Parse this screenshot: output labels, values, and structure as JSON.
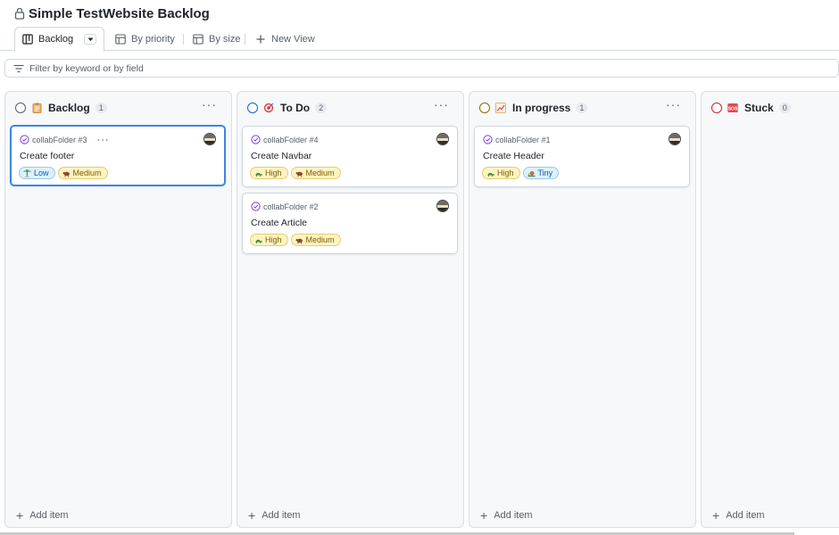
{
  "project": {
    "title": "Simple TestWebsite Backlog"
  },
  "tabs": [
    {
      "label": "Backlog",
      "icon": "board-icon",
      "active": true
    },
    {
      "label": "By priority",
      "icon": "table-icon"
    },
    {
      "label": "By size",
      "icon": "table-icon"
    },
    {
      "label": "New View",
      "icon": "plus-icon"
    }
  ],
  "filter": {
    "placeholder": "Filter by keyword or by field"
  },
  "columns": [
    {
      "name": "Backlog",
      "count": "1",
      "status_color": "#57606a",
      "emoji": "clipboard",
      "add_label": "Add item",
      "cards": [
        {
          "ref": "collabFolder #3",
          "title": "Create footer",
          "selected": true,
          "labels": [
            {
              "text": "Low",
              "color": "blue",
              "icon": "palm-tree"
            },
            {
              "text": "Medium",
              "color": "yellow",
              "icon": "ox"
            }
          ]
        }
      ]
    },
    {
      "name": "To Do",
      "count": "2",
      "status_color": "#0969da",
      "emoji": "target",
      "add_label": "Add item",
      "cards": [
        {
          "ref": "collabFolder #4",
          "title": "Create Navbar",
          "labels": [
            {
              "text": "High",
              "color": "yellow",
              "icon": "turtle"
            },
            {
              "text": "Medium",
              "color": "yellow",
              "icon": "ox"
            }
          ]
        },
        {
          "ref": "collabFolder #2",
          "title": "Create Article",
          "labels": [
            {
              "text": "High",
              "color": "yellow",
              "icon": "turtle"
            },
            {
              "text": "Medium",
              "color": "yellow",
              "icon": "ox"
            }
          ]
        }
      ]
    },
    {
      "name": "In progress",
      "count": "1",
      "status_color": "#9a6700",
      "emoji": "chart",
      "add_label": "Add item",
      "cards": [
        {
          "ref": "collabFolder #1",
          "title": "Create Header",
          "labels": [
            {
              "text": "High",
              "color": "yellow",
              "icon": "turtle"
            },
            {
              "text": "Tiny",
              "color": "blue",
              "icon": "snail"
            }
          ]
        }
      ]
    },
    {
      "name": "Stuck",
      "count": "0",
      "status_color": "#cf222e",
      "emoji": "sos",
      "add_label": "Add item",
      "cards": []
    }
  ],
  "colors": {
    "accent": "#3d86e0",
    "issue_purple": "#8250df"
  }
}
